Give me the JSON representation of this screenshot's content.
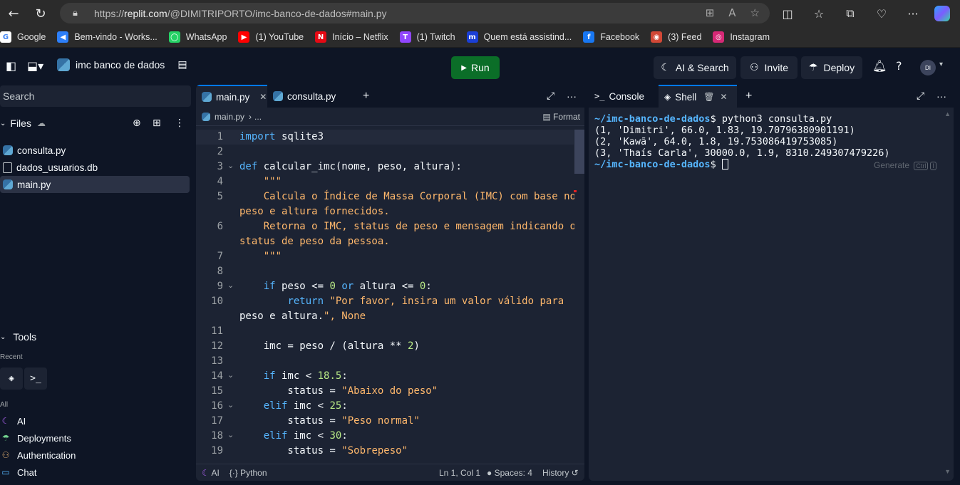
{
  "browser": {
    "url_prefix": "https://",
    "url_host": "replit.com",
    "url_path": "/@DIMITRIPORTO/imc-banco-de-dados#main.py",
    "bookmarks": [
      {
        "label": "Google",
        "color": "#ffffff",
        "glyph": "G"
      },
      {
        "label": "Bem-vindo - Works...",
        "color": "#2d7ff9",
        "glyph": "◀"
      },
      {
        "label": "WhatsApp",
        "color": "#25d366",
        "glyph": "◯"
      },
      {
        "label": "(1) YouTube",
        "color": "#ff0000",
        "glyph": "▶"
      },
      {
        "label": "Início – Netflix",
        "color": "#e50914",
        "glyph": "N"
      },
      {
        "label": "(1) Twitch",
        "color": "#9146ff",
        "glyph": "T"
      },
      {
        "label": "Quem está assistind...",
        "color": "#1a3fd6",
        "glyph": "m"
      },
      {
        "label": "Facebook",
        "color": "#1877f2",
        "glyph": "f"
      },
      {
        "label": "(3) Feed",
        "color": "#d14836",
        "glyph": "◉"
      },
      {
        "label": "Instagram",
        "color": "#d62976",
        "glyph": "◎"
      }
    ]
  },
  "topbar": {
    "repl_name": "imc banco de dados",
    "run_label": "Run",
    "ai_search_label": "AI & Search",
    "invite_label": "Invite",
    "deploy_label": "Deploy",
    "avatar_initials": "DI"
  },
  "sidebar": {
    "search_placeholder": "Search",
    "files_label": "Files",
    "files": [
      {
        "name": "consulta.py",
        "type": "python"
      },
      {
        "name": "dados_usuarios.db",
        "type": "db"
      },
      {
        "name": "main.py",
        "type": "python",
        "active": true
      }
    ],
    "tools_label": "Tools",
    "recent_label": "Recent",
    "all_label": "All",
    "tools": [
      "AI",
      "Deployments",
      "Authentication",
      "Chat"
    ]
  },
  "editor": {
    "tabs": [
      "main.py",
      "consulta.py"
    ],
    "breadcrumb": "main.py",
    "breadcrumb_more": "...",
    "format_label": "Format",
    "status": {
      "ai": "AI",
      "language": "Python",
      "position": "Ln 1, Col 1",
      "spaces": "Spaces: 4",
      "history": "History"
    },
    "lines": [
      {
        "n": "1",
        "text": "import sqlite3"
      },
      {
        "n": "2",
        "text": ""
      },
      {
        "n": "3",
        "text": "def calcular_imc(nome, peso, altura):",
        "fold": true
      },
      {
        "n": "4",
        "text": "    \"\"\""
      },
      {
        "n": "5",
        "text": "    Calcula o Índice de Massa Corporal (IMC) com base no"
      },
      {
        "n": "",
        "text": "peso e altura fornecidos."
      },
      {
        "n": "6",
        "text": "    Retorna o IMC, status de peso e mensagem indicando o"
      },
      {
        "n": "",
        "text": "status de peso da pessoa."
      },
      {
        "n": "7",
        "text": "    \"\"\""
      },
      {
        "n": "8",
        "text": ""
      },
      {
        "n": "9",
        "text": "    if peso <= 0 or altura <= 0:",
        "fold": true
      },
      {
        "n": "10",
        "text": "        return \"Por favor, insira um valor válido para"
      },
      {
        "n": "",
        "text": "peso e altura.\", None"
      },
      {
        "n": "11",
        "text": ""
      },
      {
        "n": "12",
        "text": "    imc = peso / (altura ** 2)"
      },
      {
        "n": "13",
        "text": ""
      },
      {
        "n": "14",
        "text": "    if imc < 18.5:",
        "fold": true
      },
      {
        "n": "15",
        "text": "        status = \"Abaixo do peso\""
      },
      {
        "n": "16",
        "text": "    elif imc < 25:",
        "fold": true
      },
      {
        "n": "17",
        "text": "        status = \"Peso normal\""
      },
      {
        "n": "18",
        "text": "    elif imc < 30:",
        "fold": true
      },
      {
        "n": "19",
        "text": "        status = \"Sobrepeso\""
      }
    ]
  },
  "shell": {
    "tabs": [
      "Console",
      "Shell"
    ],
    "prompt": "~/imc-banco-de-dados",
    "command": "$ python3 consulta.py",
    "output": [
      "(1, 'Dimitri', 66.0, 1.83, 19.70796380901191)",
      "(2, 'Kawã', 64.0, 1.8, 19.753086419753085)",
      "(3, 'Thaís Carla', 30000.0, 1.9, 8310.249307479226)"
    ],
    "prompt_end": "$ ",
    "generate_label": "Generate",
    "generate_key1": "Ctrl",
    "generate_key2": "I"
  }
}
